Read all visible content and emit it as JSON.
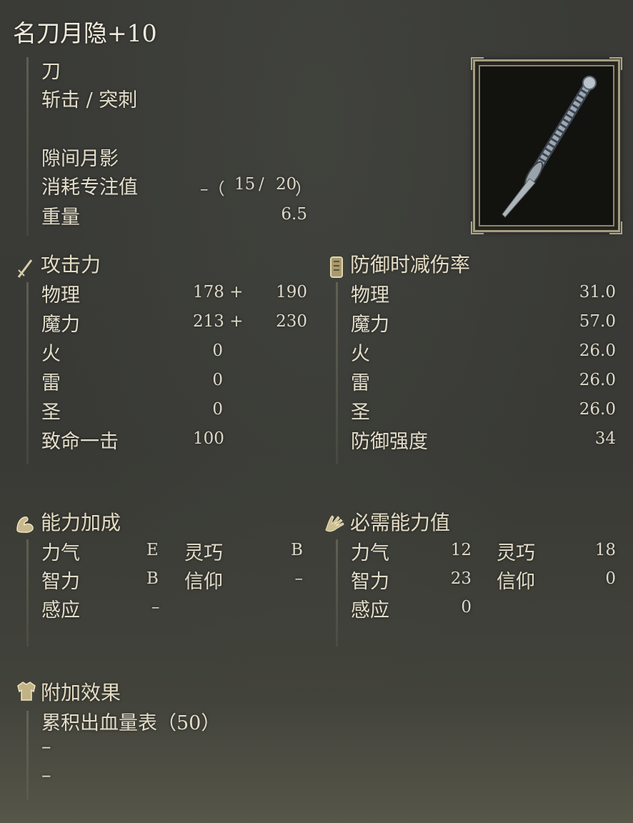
{
  "weapon": {
    "name": "名刀月隐+10",
    "type": "刀",
    "attack_type": "斩击 / 突刺",
    "skill": "隙间月影",
    "fp_cost_label": "消耗专注值",
    "fp_cost_prefix": "–（",
    "fp_cost_a": "15",
    "fp_cost_sep": "/",
    "fp_cost_b": "20",
    "fp_cost_suffix": "）",
    "weight_label": "重量",
    "weight": "6.5",
    "image_icon": "katana-icon"
  },
  "attack": {
    "header": "攻击力",
    "icon": "sword-icon",
    "rows": [
      {
        "label": "物理",
        "base": "178 +",
        "bonus": "190"
      },
      {
        "label": "魔力",
        "base": "213 +",
        "bonus": "230"
      },
      {
        "label": "火",
        "base": "0",
        "bonus": ""
      },
      {
        "label": "雷",
        "base": "0",
        "bonus": ""
      },
      {
        "label": "圣",
        "base": "0",
        "bonus": ""
      },
      {
        "label": "致命一击",
        "base": "100",
        "bonus": ""
      }
    ]
  },
  "guard": {
    "header": "防御时减伤率",
    "icon": "shield-icon",
    "rows": [
      {
        "label": "物理",
        "value": "31.0"
      },
      {
        "label": "魔力",
        "value": "57.0"
      },
      {
        "label": "火",
        "value": "26.0"
      },
      {
        "label": "雷",
        "value": "26.0"
      },
      {
        "label": "圣",
        "value": "26.0"
      },
      {
        "label": "防御强度",
        "value": "34"
      }
    ]
  },
  "scaling": {
    "header": "能力加成",
    "icon": "arm-flex-icon",
    "rows": [
      {
        "l1": "力气",
        "v1": "E",
        "l2": "灵巧",
        "v2": "B"
      },
      {
        "l1": "智力",
        "v1": "B",
        "l2": "信仰",
        "v2": "–"
      },
      {
        "l1": "感应",
        "v1": "–",
        "l2": "",
        "v2": ""
      }
    ]
  },
  "requirements": {
    "header": "必需能力值",
    "icon": "hand-icon",
    "rows": [
      {
        "l1": "力气",
        "v1": "12",
        "l2": "灵巧",
        "v2": "18"
      },
      {
        "l1": "智力",
        "v1": "23",
        "l2": "信仰",
        "v2": "0"
      },
      {
        "l1": "感应",
        "v1": "0",
        "l2": "",
        "v2": ""
      }
    ]
  },
  "effects": {
    "header": "附加效果",
    "icon": "armor-icon",
    "lines": [
      "累积出血量表（50）",
      "–",
      "–"
    ]
  }
}
